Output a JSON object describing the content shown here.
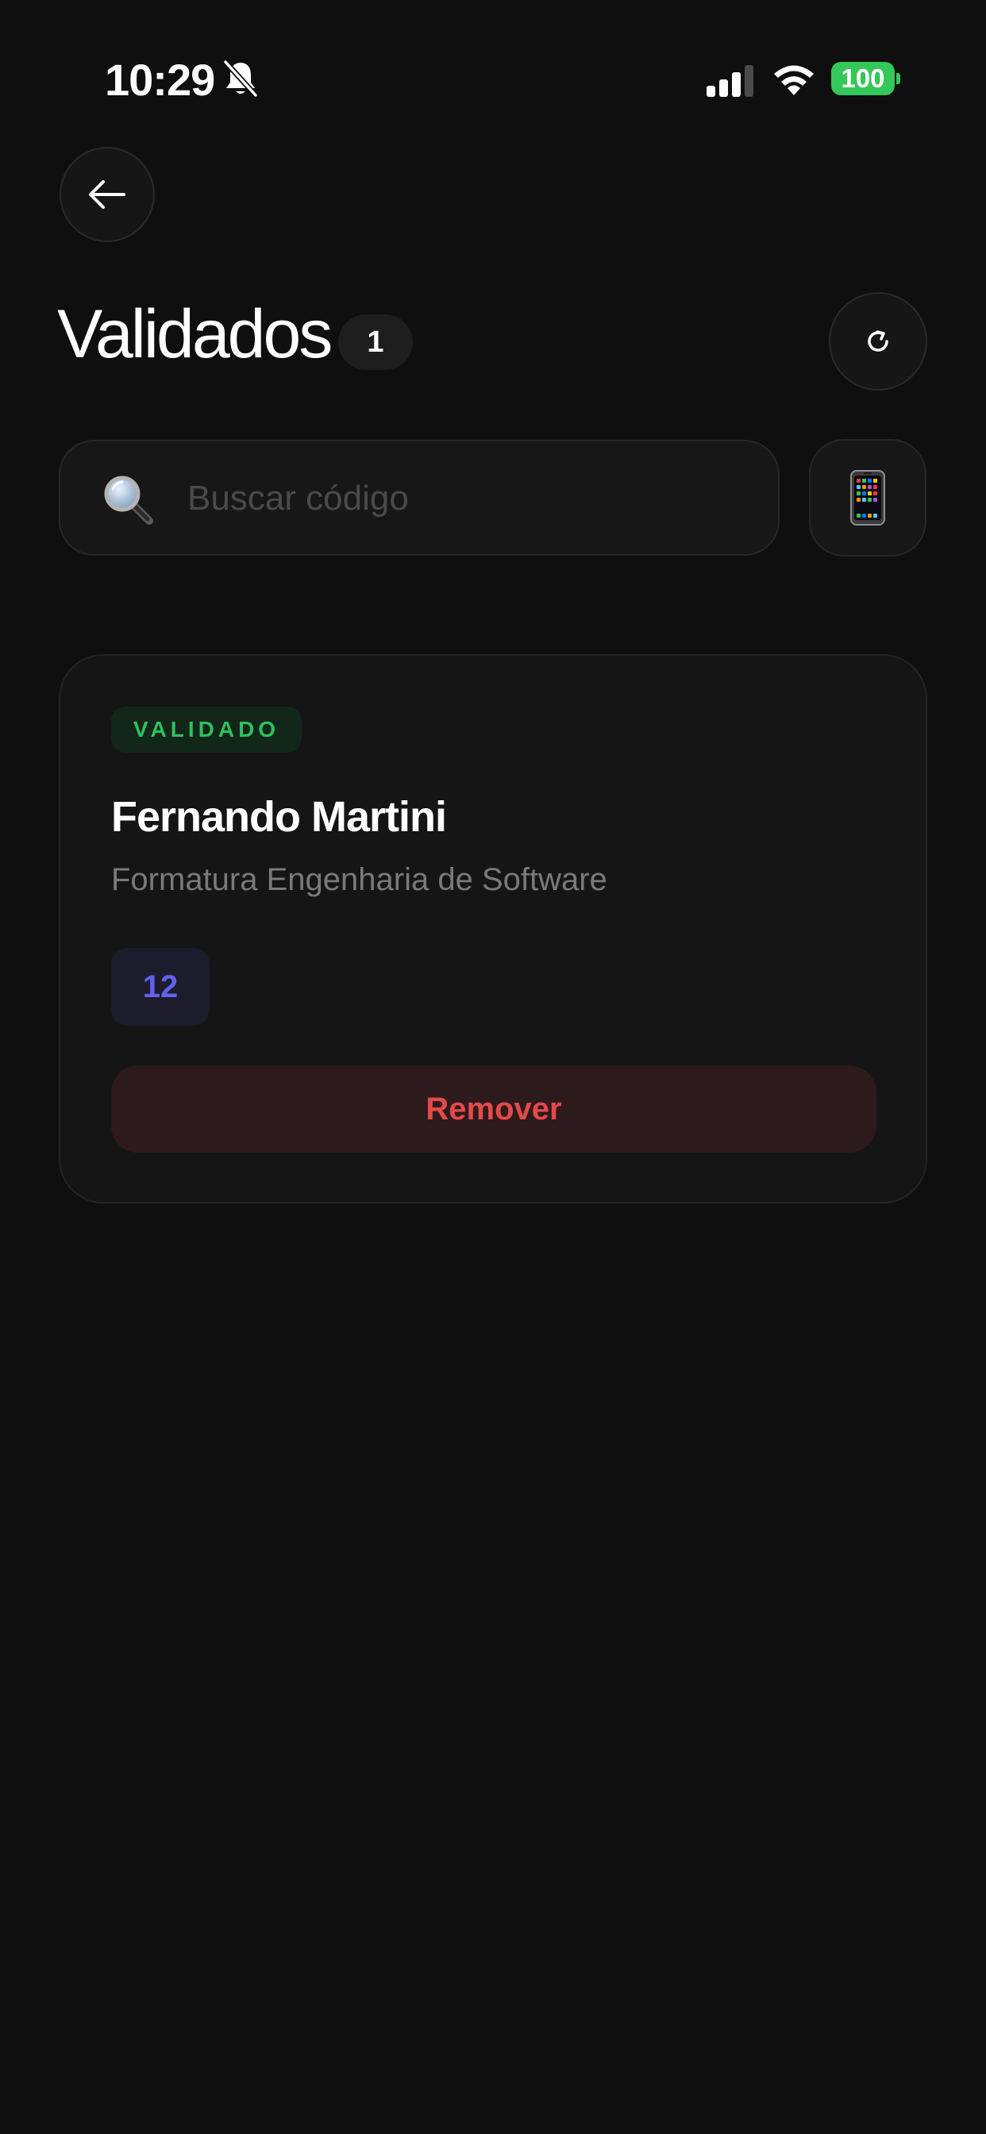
{
  "status_bar": {
    "time": "10:29",
    "battery": "100",
    "icons": [
      "bell-slash-icon",
      "cellular-signal-icon",
      "wifi-icon",
      "battery-icon"
    ]
  },
  "header": {
    "back_icon": "arrow-left-icon",
    "title": "Validados",
    "count": "1",
    "refresh_icon": "refresh-icon"
  },
  "search": {
    "icon": "magnifying-glass-icon",
    "placeholder": "Buscar código",
    "value": "",
    "device_icon": "mobile-phone-icon"
  },
  "tickets": [
    {
      "status": "VALIDADO",
      "name": "Fernando Martini",
      "event": "Formatura Engenharia de Software",
      "number": "12",
      "action_label": "Remover"
    }
  ],
  "colors": {
    "background": "#0f0f0f",
    "card": "#151515",
    "validated_green": "#2fc05e",
    "ticket_number_purple": "#6360f0",
    "remove_red": "#e6484a",
    "battery_green": "#34c759"
  }
}
